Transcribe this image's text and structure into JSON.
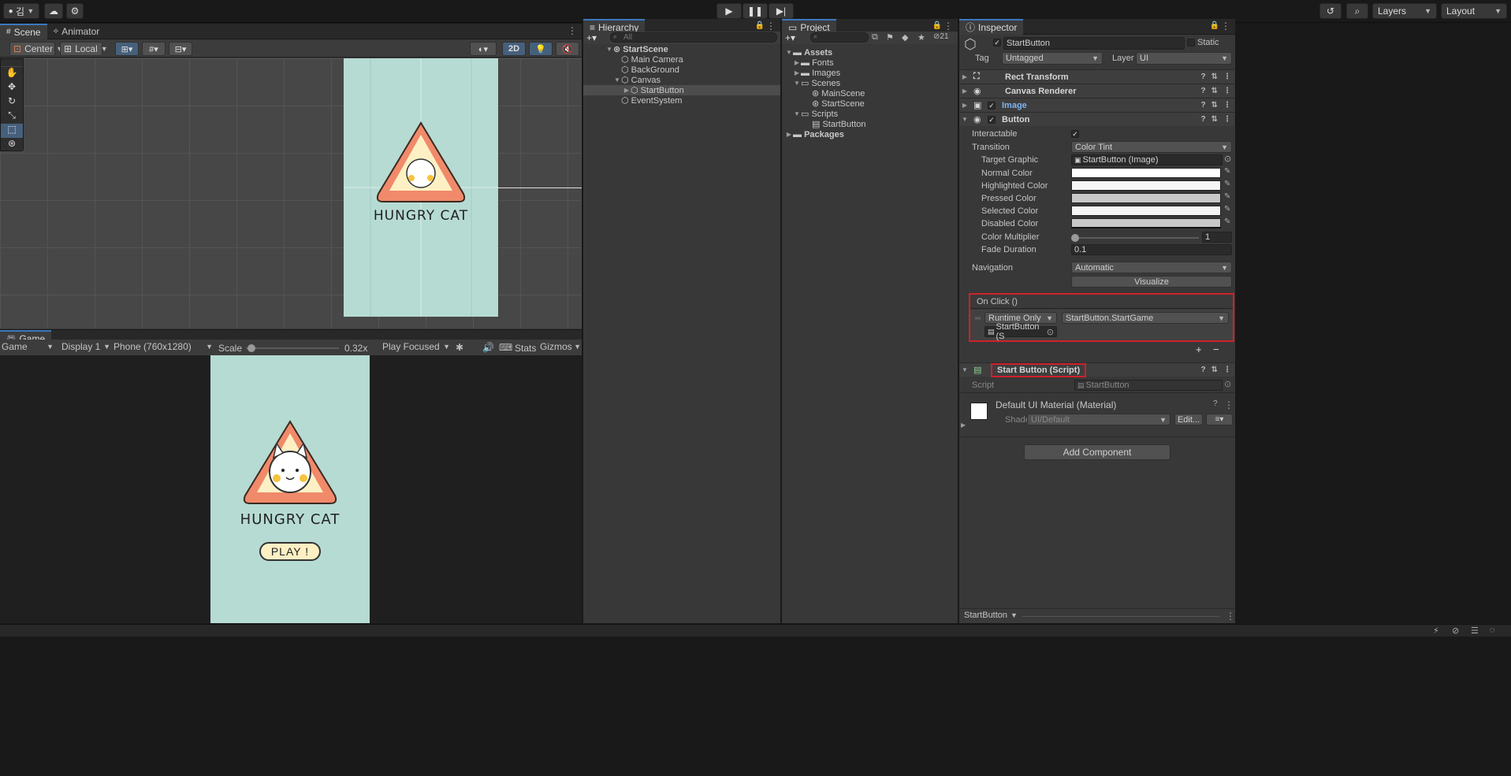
{
  "toolbar": {
    "account_label": "김",
    "layers_label": "Layers",
    "layout_label": "Layout"
  },
  "scene_panel": {
    "tabs": [
      "Scene",
      "Animator"
    ],
    "pivot_label": "Center",
    "space_label": "Local",
    "mode_2d_label": "2D"
  },
  "game_panel": {
    "tab_label": "Game",
    "view_dropdown": "Game",
    "display_dropdown": "Display 1",
    "resolution_dropdown": "Phone (760x1280)",
    "scale_label": "Scale",
    "scale_value": "0.32x",
    "scale_fraction": 0.02,
    "play_focused_label": "Play Focused",
    "stats_label": "Stats",
    "gizmos_label": "Gizmos"
  },
  "game_art": {
    "title": "HUNGRY CAT",
    "play_button": "PLAY !",
    "bg_color": "#b6dbd3",
    "triangle_outer": "#f08a6a",
    "triangle_inner": "#fdf0c4"
  },
  "hierarchy": {
    "tab_label": "Hierarchy",
    "search_placeholder": "All",
    "items": [
      {
        "label": "StartScene"
      },
      {
        "label": "Main Camera"
      },
      {
        "label": "BackGround"
      },
      {
        "label": "Canvas"
      },
      {
        "label": "StartButton"
      },
      {
        "label": "EventSystem"
      }
    ]
  },
  "project": {
    "tab_label": "Project",
    "hidden_count": "21",
    "items": [
      {
        "label": "Assets"
      },
      {
        "label": "Fonts"
      },
      {
        "label": "Images"
      },
      {
        "label": "Scenes"
      },
      {
        "label": "MainScene"
      },
      {
        "label": "StartScene"
      },
      {
        "label": "Scripts"
      },
      {
        "label": "StartButton"
      },
      {
        "label": "Packages"
      }
    ]
  },
  "inspector": {
    "tab_label": "Inspector",
    "object_name": "StartButton",
    "static_label": "Static",
    "tag_label": "Tag",
    "tag_value": "Untagged",
    "layer_label": "Layer",
    "layer_value": "UI",
    "components": {
      "rect_transform": "Rect Transform",
      "canvas_renderer": "Canvas Renderer",
      "image": "Image",
      "button": "Button"
    },
    "button": {
      "interactable_label": "Interactable",
      "transition_label": "Transition",
      "transition_value": "Color Tint",
      "target_graphic_label": "Target Graphic",
      "target_graphic_value": "StartButton (Image)",
      "normal_color_label": "Normal Color",
      "highlighted_color_label": "Highlighted Color",
      "pressed_color_label": "Pressed Color",
      "selected_color_label": "Selected Color",
      "disabled_color_label": "Disabled Color",
      "color_multiplier_label": "Color Multiplier",
      "color_multiplier_value": "1",
      "color_multiplier_fraction": 0.0,
      "fade_duration_label": "Fade Duration",
      "fade_duration_value": "0.1",
      "navigation_label": "Navigation",
      "navigation_value": "Automatic",
      "visualize_label": "Visualize",
      "colors": {
        "normal": "#ffffff",
        "highlighted": "#f5f5f5",
        "pressed": "#c8c8c8",
        "selected": "#f5f5f5",
        "disabled": "#c8c8c8"
      }
    },
    "on_click": {
      "header": "On Click ()",
      "runtime_value": "Runtime Only",
      "function_value": "StartButton.StartGame",
      "object_value": "StartButton (S"
    },
    "script_component": {
      "header": "Start Button (Script)",
      "script_label": "Script",
      "script_value": "StartButton"
    },
    "material": {
      "name": "Default UI Material (Material)",
      "shader_label": "Shader",
      "shader_value": "UI/Default",
      "edit_label": "Edit..."
    },
    "add_component_label": "Add Component",
    "footer_label": "StartButton"
  }
}
